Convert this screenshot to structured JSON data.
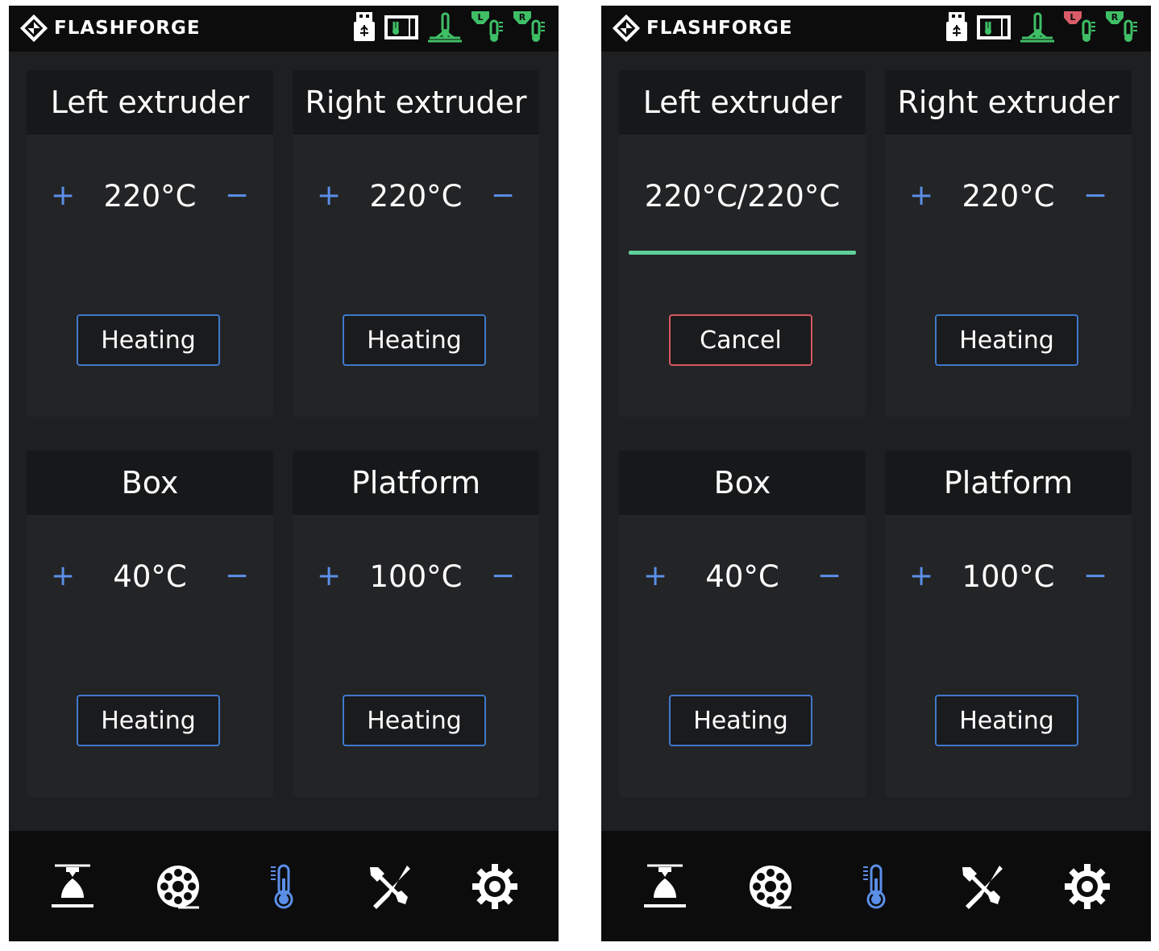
{
  "screens": [
    {
      "brand": "FLASHFORGE",
      "status_icons": [
        "usb-icon",
        "camera-icon",
        "platform-heat-icon",
        "left-extruder-heat-icon",
        "right-extruder-heat-icon"
      ],
      "status_colors": {
        "left_extruder": "#3fbf66",
        "right_extruder": "#3fbf66"
      },
      "cards": [
        {
          "title": "Left extruder",
          "temp": "220°C",
          "plus": "+",
          "minus": "−",
          "button": "Heating",
          "state": "idle"
        },
        {
          "title": "Right extruder",
          "temp": "220°C",
          "plus": "+",
          "minus": "−",
          "button": "Heating",
          "state": "idle"
        },
        {
          "title": "Box",
          "temp": "40°C",
          "plus": "+",
          "minus": "−",
          "button": "Heating",
          "state": "idle"
        },
        {
          "title": "Platform",
          "temp": "100°C",
          "plus": "+",
          "minus": "−",
          "button": "Heating",
          "state": "idle"
        }
      ],
      "nav": [
        "print-icon",
        "filament-icon",
        "temperature-icon",
        "tools-icon",
        "settings-icon"
      ],
      "nav_active": "temperature-icon"
    },
    {
      "brand": "FLASHFORGE",
      "status_icons": [
        "usb-icon",
        "camera-icon",
        "platform-heat-icon",
        "left-extruder-heat-icon",
        "right-extruder-heat-icon"
      ],
      "status_colors": {
        "left_extruder": "#d95c68",
        "right_extruder": "#3fbf66"
      },
      "cards": [
        {
          "title": "Left extruder",
          "temp": "220°C/220°C",
          "button": "Cancel",
          "state": "heating",
          "progress": 1.0
        },
        {
          "title": "Right extruder",
          "temp": "220°C",
          "plus": "+",
          "minus": "−",
          "button": "Heating",
          "state": "idle"
        },
        {
          "title": "Box",
          "temp": "40°C",
          "plus": "+",
          "minus": "−",
          "button": "Heating",
          "state": "idle"
        },
        {
          "title": "Platform",
          "temp": "100°C",
          "plus": "+",
          "minus": "−",
          "button": "Heating",
          "state": "idle"
        }
      ],
      "nav": [
        "print-icon",
        "filament-icon",
        "temperature-icon",
        "tools-icon",
        "settings-icon"
      ],
      "nav_active": "temperature-icon"
    }
  ],
  "colors": {
    "accent": "#5b8fe8",
    "button_border": "#3f79cc",
    "cancel_border": "#d45863",
    "progress": "#5fcf9a",
    "status_green": "#3fbf66",
    "status_red": "#d95c68"
  }
}
